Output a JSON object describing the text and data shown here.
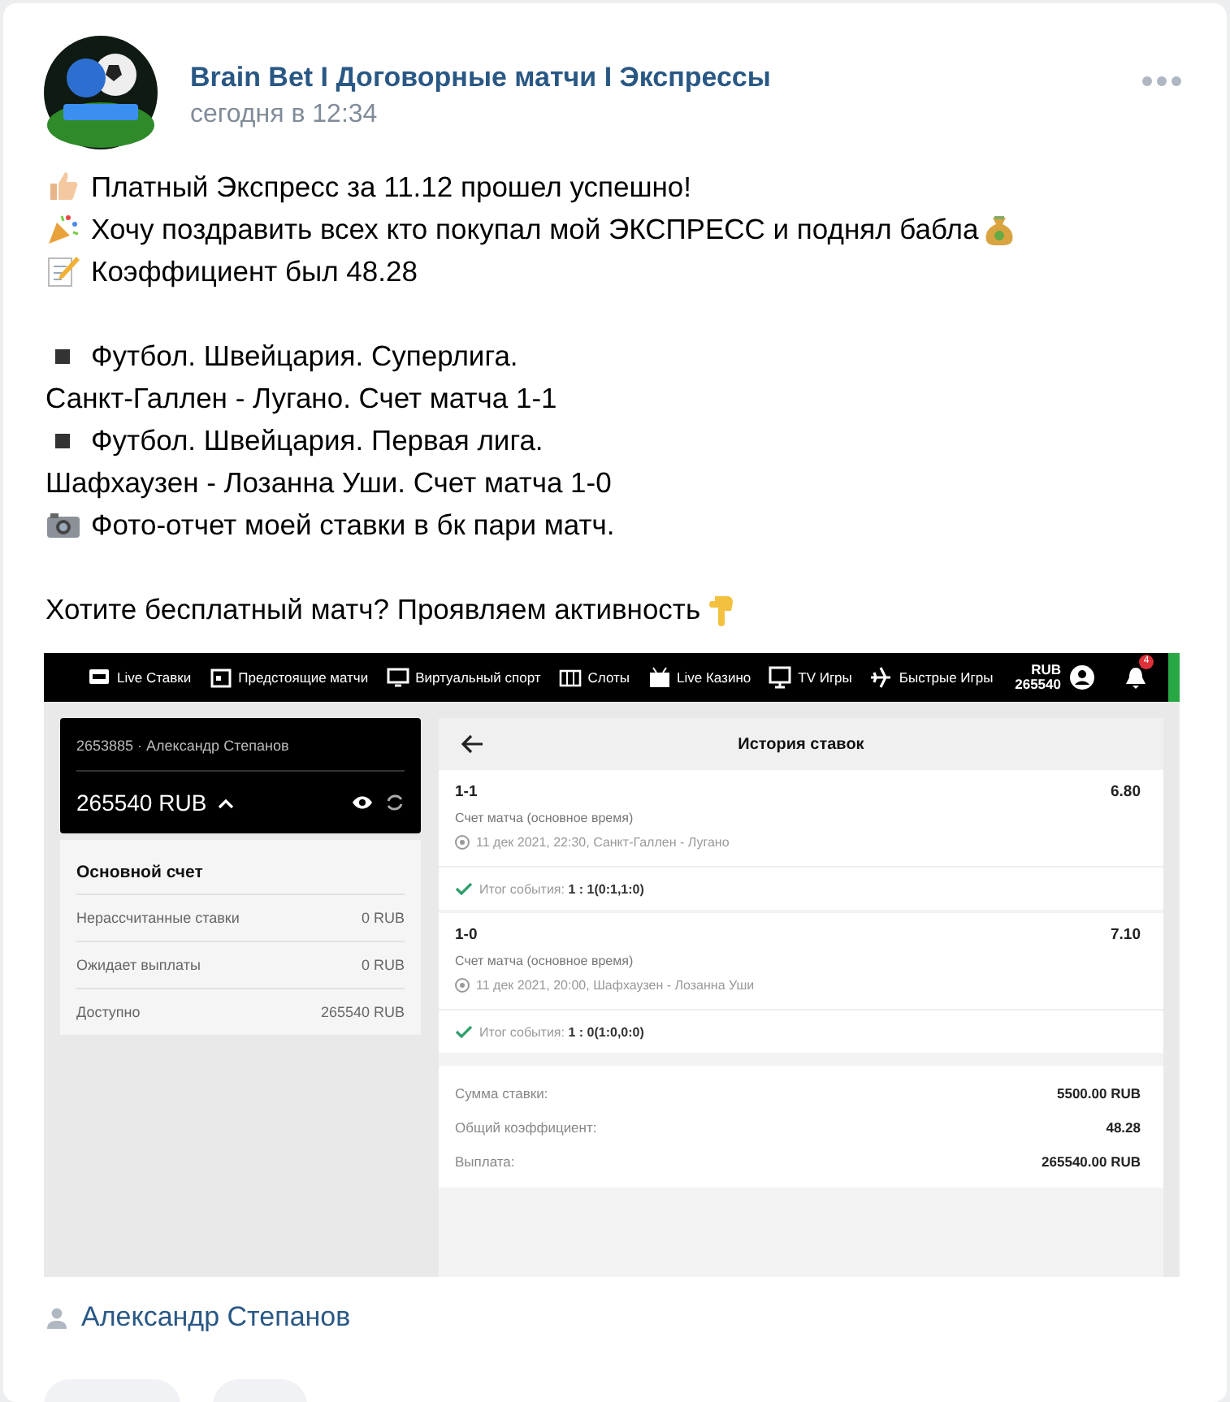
{
  "post": {
    "author": "Brain Bet I Договорные матчи I Экспрессы",
    "time": "сегодня в 12:34",
    "paragraphs": [
      [
        "Платный Экспресс за 11.12 прошел успешно!",
        "Хочу поздравить всех кто покупал мой ЭКСПРЕСС и поднял бабла",
        "Коэффициент был 48.28"
      ],
      [
        "Футбол. Швейцария. Суперлига.",
        "Санкт-Галлен - Лугано. Счет матча 1-1",
        "Футбол. Швейцария. Первая лига.",
        "Шафхаузен - Лозанна Уши. Счет матча 1-0",
        "Фото-отчет моей ставки в бк пари матч."
      ],
      [
        "Хотите бесплатный матч? Проявляем активность"
      ]
    ],
    "signer": "Александр Степанов"
  },
  "screenshot": {
    "nav": [
      "Live Ставки",
      "Предстоящие матчи",
      "Виртуальный спорт",
      "Слоты",
      "Live Казино",
      "TV Игры",
      "Быстрые Игры"
    ],
    "currency": "RUB",
    "balance": "265540",
    "notifications": "4",
    "account": {
      "user": "2653885 · Александр Степанов",
      "balance": "265540 RUB",
      "title": "Основной счет",
      "rows": [
        {
          "label": "Нерассчитанные ставки",
          "value": "0 RUB"
        },
        {
          "label": "Ожидает выплаты",
          "value": "0 RUB"
        },
        {
          "label": "Доступно",
          "value": "265540 RUB"
        }
      ]
    },
    "history": {
      "title": "История ставок",
      "bets": [
        {
          "pick": "1-1",
          "odds": "6.80",
          "market": "Счет матча (основное время)",
          "event": "11 дек 2021, 22:30, Санкт-Галлен - Лугано",
          "result": "Итог события: **1 : 1(0:1,1:0)**"
        },
        {
          "pick": "1-0",
          "odds": "7.10",
          "market": "Счет матча (основное время)",
          "event": "11 дек 2021, 20:00, Шафхаузен - Лозанна Уши",
          "result": "Итог события: **1 : 0(1:0,0:0)**"
        }
      ],
      "summary": [
        {
          "label": "Сумма ставки:",
          "value": "5500.00 RUB"
        },
        {
          "label": "Общий коэффициент:",
          "value": "48.28"
        },
        {
          "label": "Выплата:",
          "value": "265540.00 RUB"
        }
      ]
    }
  }
}
